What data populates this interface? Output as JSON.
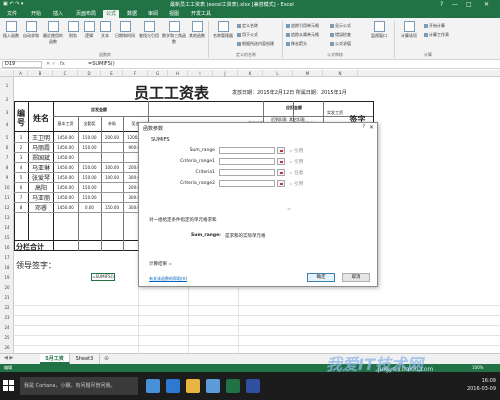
{
  "window": {
    "title": "最新员工工资表 (excel工资表).xlsx [兼容模式] - Excel",
    "controls": [
      "?",
      "—",
      "□",
      "✕"
    ]
  },
  "ribbon_tabs": [
    "文件",
    "开始",
    "插入",
    "页面布局",
    "公式",
    "数据",
    "审阅",
    "视图",
    "开发工具"
  ],
  "ribbon": {
    "insert_function": "插入函数",
    "autosum": "自动求和",
    "recent": "最近使用的函数",
    "financial": "财务",
    "logical": "逻辑",
    "text": "文本",
    "datetime": "日期和时间",
    "lookup": "查找与引用",
    "math": "数学和三角函数",
    "more": "其他函数",
    "name_manager": "名称管理器",
    "define_name": "定义名称",
    "use_in_formula": "用于公式",
    "create_from_selection": "根据所选内容创建",
    "trace_precedents": "追踪引用单元格",
    "trace_dependents": "追踪从属单元格",
    "remove_arrows": "移去箭头",
    "show_formulas": "显示公式",
    "error_checking": "错误检查",
    "evaluate": "公式求值",
    "watch_window": "监视窗口",
    "calc_options": "计算选项",
    "calc_now": "开始计算",
    "calc_sheet": "计算工作表",
    "group_library": "函数库",
    "group_names": "定义的名称",
    "group_audit": "公式审核",
    "group_calc": "计算"
  },
  "formula_bar": {
    "name_box": "D19",
    "fx": "fx",
    "formula": "=SUMIFS()"
  },
  "columns": [
    "A",
    "B",
    "C",
    "D",
    "E",
    "F",
    "G",
    "H",
    "I",
    "J",
    "K",
    "L",
    "M",
    "N"
  ],
  "rows": [
    "1",
    "2",
    "3",
    "4",
    "5",
    "6",
    "7",
    "8",
    "9",
    "10",
    "11",
    "12",
    "13",
    "14",
    "15",
    "16",
    "17",
    "18",
    "19",
    "20",
    "21",
    "22",
    "23",
    "24",
    "25",
    "26",
    "27"
  ],
  "sheet": {
    "title": "员工工资表",
    "issue_date": "发放日期：2015年2月12日 所属日期：2015年1月",
    "col_no": "编号",
    "col_name": "姓名",
    "group_pay": "应发金额",
    "group_deduct": "应扣金额",
    "col_base": "基本工资",
    "col_full": "全勤奖",
    "col_subsidy": "补助",
    "col_bonus": "奖金",
    "col_deduct1": "事假扣款",
    "col_deduct2": "迟到扣款",
    "col_deduct3": "其它扣款",
    "col_deduct_total": "应扣合计",
    "col_actual": "实发工资",
    "col_sign": "签字",
    "employees": [
      {
        "no": "1",
        "name": "王卫明",
        "base": "1450.00",
        "full": "150.00",
        "subsidy": "200.00",
        "bonus": "1200.00"
      },
      {
        "no": "2",
        "name": "马丽霞",
        "base": "1450.00",
        "full": "150.00",
        "subsidy": "",
        "bonus": "900.00"
      },
      {
        "no": "3",
        "name": "郑国斌",
        "base": "1450.00",
        "full": "",
        "subsidy": "",
        "bonus": ""
      },
      {
        "no": "4",
        "name": "马亚琳",
        "base": "1450.00",
        "full": "150.00",
        "subsidy": "100.00",
        "bonus": "200.00"
      },
      {
        "no": "5",
        "name": "张爱琴",
        "base": "1450.00",
        "full": "150.00",
        "subsidy": "100.00",
        "bonus": "300.00"
      },
      {
        "no": "6",
        "name": "高阳",
        "base": "1450.00",
        "full": "150.00",
        "subsidy": "",
        "bonus": "200.00"
      },
      {
        "no": "7",
        "name": "马亚丽",
        "base": "1450.00",
        "full": "150.00",
        "subsidy": "",
        "bonus": "300.00"
      },
      {
        "no": "8",
        "name": "邓睿",
        "base": "1450.00",
        "full": "0.00",
        "subsidy": "150.00",
        "bonus": "300.00"
      }
    ],
    "subtotal": "分栏合计",
    "leader_sign": "领导签字：",
    "active_cell": "=SUMIFS()"
  },
  "dialog": {
    "title": "函数参数",
    "help": "?",
    "close": "✕",
    "function": "SUMIFS",
    "args": [
      {
        "label": "Sum_range",
        "value": "= 引用"
      },
      {
        "label": "Criteria_range1",
        "value": "= 引用"
      },
      {
        "label": "Criteria1",
        "value": "= 任意"
      },
      {
        "label": "Criteria_range2",
        "value": "= 引用"
      }
    ],
    "equals": "=",
    "description": "对一组给定条件指定的单元格求和",
    "arg_help_name": "Sum_range:",
    "arg_help_text": "是求和的实际单元格",
    "result_label": "计算结果 =",
    "help_link": "有关该函数的帮助(H)",
    "ok": "确定",
    "cancel": "取消"
  },
  "sheet_tabs": [
    "5月工资",
    "Sheet3"
  ],
  "status_bar": {
    "left": "编辑",
    "zoom": "100%"
  },
  "taskbar": {
    "search": "我是 Cortana，小娜。有问题尽管问我。",
    "time": "16:09",
    "date": "2016-03-09"
  },
  "watermark": {
    "main": "我爱IT技术网",
    "sub": "jingyan.baidu.com"
  },
  "colors": {
    "excel_green": "#217346",
    "link": "#0563c1",
    "taskbar": "#1c1c1c"
  }
}
